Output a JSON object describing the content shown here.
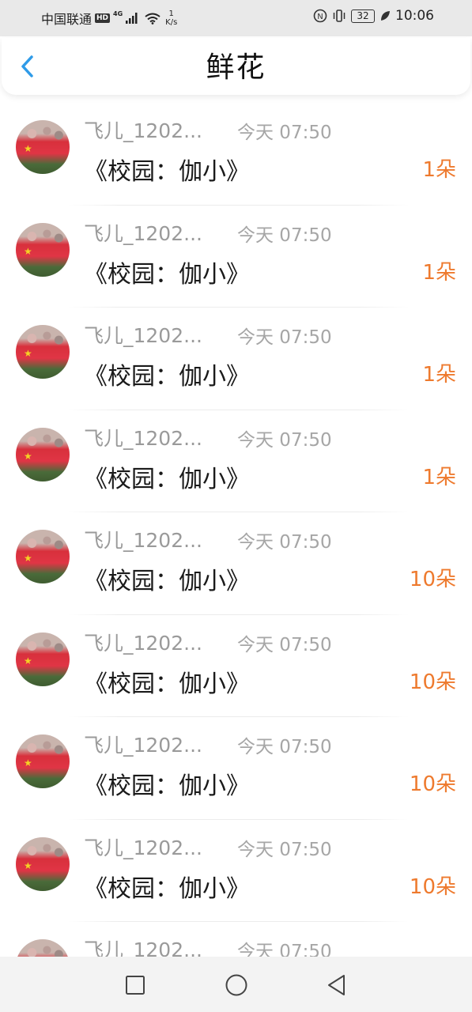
{
  "status_bar": {
    "carrier": "中国联通",
    "hd_badge": "HD",
    "network": "4G",
    "speed_value": "1",
    "speed_unit": "K/s",
    "nfc": "N",
    "battery": "32",
    "time": "10:06"
  },
  "header": {
    "title": "鲜花",
    "back_icon": "chevron-left-icon"
  },
  "items": [
    {
      "name": "飞儿_1202...",
      "time": "今天 07:50",
      "title": "《校园：伽小》",
      "count": "1朵"
    },
    {
      "name": "飞儿_1202...",
      "time": "今天 07:50",
      "title": "《校园：伽小》",
      "count": "1朵"
    },
    {
      "name": "飞儿_1202...",
      "time": "今天 07:50",
      "title": "《校园：伽小》",
      "count": "1朵"
    },
    {
      "name": "飞儿_1202...",
      "time": "今天 07:50",
      "title": "《校园：伽小》",
      "count": "1朵"
    },
    {
      "name": "飞儿_1202...",
      "time": "今天 07:50",
      "title": "《校园：伽小》",
      "count": "10朵"
    },
    {
      "name": "飞儿_1202...",
      "time": "今天 07:50",
      "title": "《校园：伽小》",
      "count": "10朵"
    },
    {
      "name": "飞儿_1202...",
      "time": "今天 07:50",
      "title": "《校园：伽小》",
      "count": "10朵"
    },
    {
      "name": "飞儿_1202...",
      "time": "今天 07:50",
      "title": "《校园：伽小》",
      "count": "10朵"
    },
    {
      "name": "飞儿_1202...",
      "time": "今天 07:50",
      "title": "",
      "count": ""
    }
  ],
  "colors": {
    "accent_blue": "#2f9be8",
    "count_orange": "#ee7a2e",
    "meta_gray": "#9a9a9a"
  },
  "navbar": {
    "icons": [
      "square-recents-icon",
      "circle-home-icon",
      "triangle-back-icon"
    ]
  }
}
